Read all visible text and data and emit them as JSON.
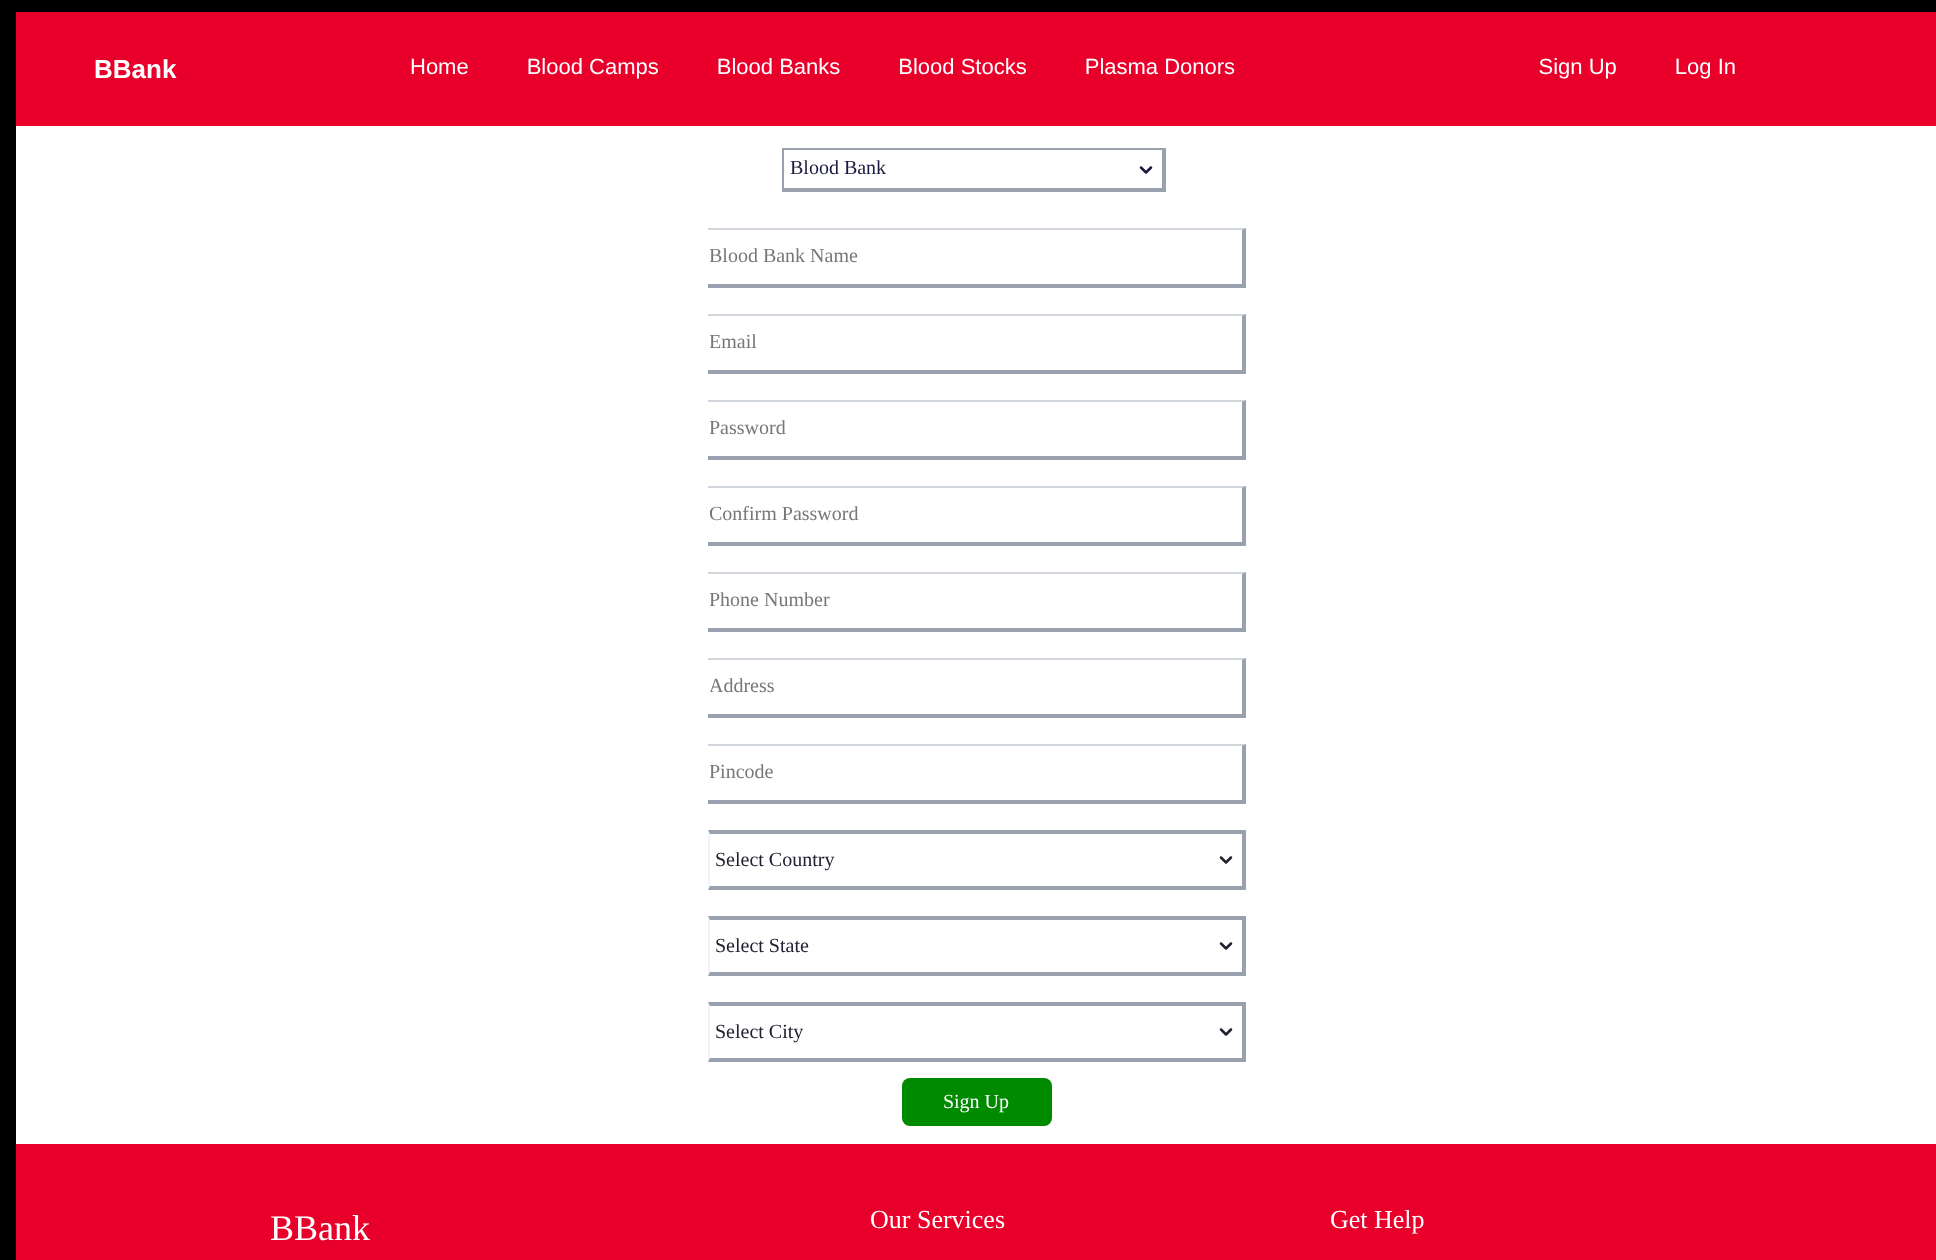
{
  "navbar": {
    "brand": "BBank",
    "links": [
      "Home",
      "Blood Camps",
      "Blood Banks",
      "Blood Stocks",
      "Plasma Donors"
    ],
    "auth_links": [
      "Sign Up",
      "Log In"
    ]
  },
  "form": {
    "account_type": "Blood Bank",
    "fields": [
      {
        "kind": "text",
        "placeholder": "Blood Bank Name"
      },
      {
        "kind": "text",
        "placeholder": "Email"
      },
      {
        "kind": "text",
        "placeholder": "Password"
      },
      {
        "kind": "text",
        "placeholder": "Confirm Password"
      },
      {
        "kind": "text",
        "placeholder": "Phone Number"
      },
      {
        "kind": "text",
        "placeholder": "Address"
      },
      {
        "kind": "text",
        "placeholder": "Pincode"
      },
      {
        "kind": "select",
        "value": "Select Country"
      },
      {
        "kind": "select",
        "value": "Select State"
      },
      {
        "kind": "select",
        "value": "Select City"
      }
    ],
    "submit": "Sign Up"
  },
  "footer": {
    "brand": "BBank",
    "headings": [
      "Our Services",
      "Get Help"
    ]
  }
}
